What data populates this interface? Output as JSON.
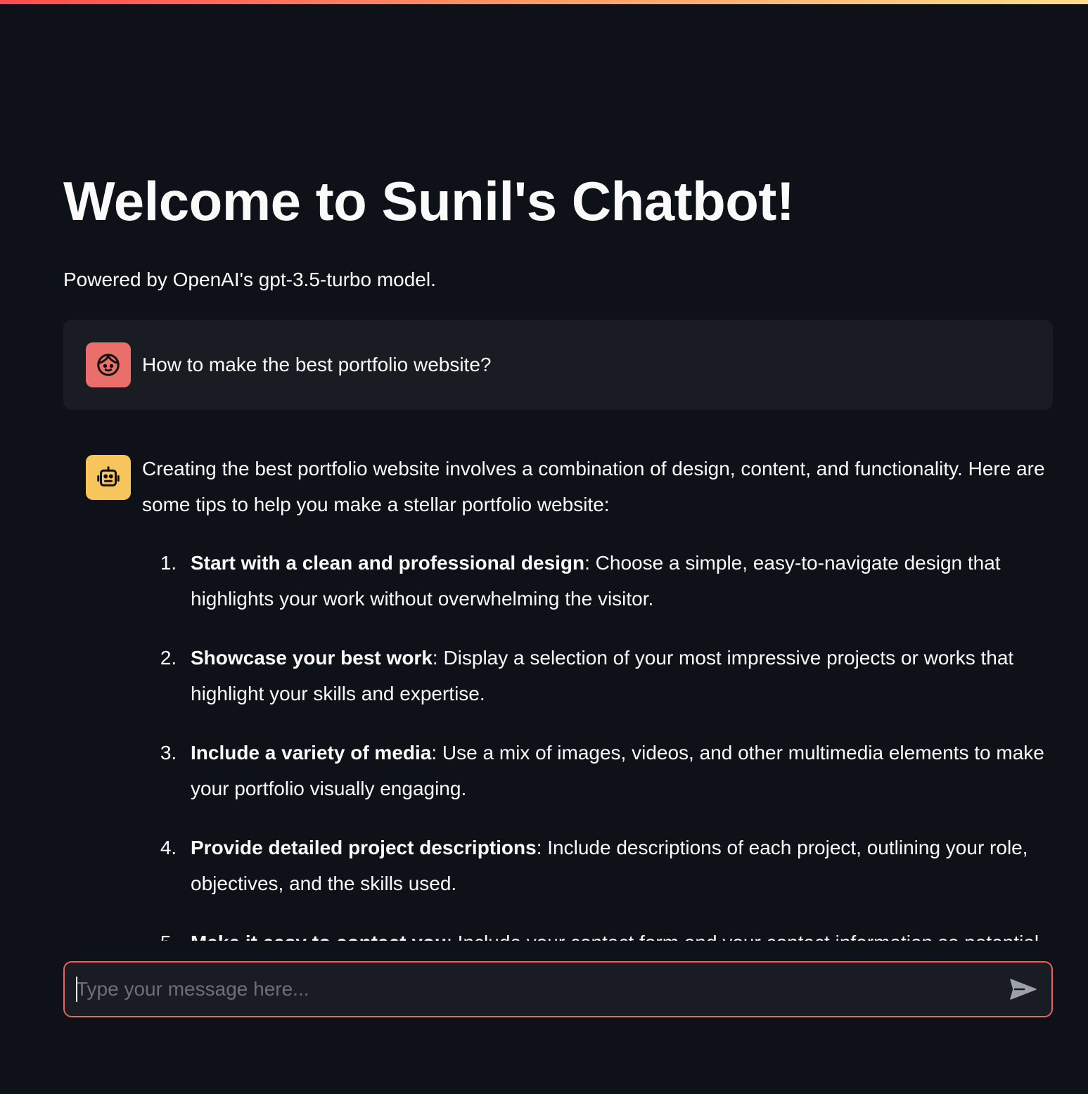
{
  "colors": {
    "background": "#0e1117",
    "text": "#fafafa",
    "user_message_bg": "#1a1c24",
    "user_avatar": "#ea6e69",
    "assistant_avatar": "#f8c45c",
    "input_border": "#e8625e"
  },
  "header": {
    "title": "Welcome to Sunil's Chatbot!",
    "subtitle": "Powered by OpenAI's gpt-3.5-turbo model."
  },
  "messages": {
    "user": {
      "avatar_icon": "smile-face-icon",
      "text": "How to make the best portfolio website?"
    },
    "assistant": {
      "avatar_icon": "robot-icon",
      "intro": "Creating the best portfolio website involves a combination of design, content, and functionality. Here are some tips to help you make a stellar portfolio website:",
      "tips": [
        {
          "title": "Start with a clean and professional design",
          "text": ": Choose a simple, easy-to-navigate design that highlights your work without overwhelming the visitor."
        },
        {
          "title": "Showcase your best work",
          "text": ": Display a selection of your most impressive projects or works that highlight your skills and expertise."
        },
        {
          "title": "Include a variety of media",
          "text": ": Use a mix of images, videos, and other multimedia elements to make your portfolio visually engaging."
        },
        {
          "title": "Provide detailed project descriptions",
          "text": ": Include descriptions of each project, outlining your role, objectives, and the skills used."
        },
        {
          "title": "Make it easy to contact you",
          "text": ": Include your contact form and your contact information so potential clients can reach you."
        }
      ]
    }
  },
  "chat_input": {
    "placeholder": "Type your message here...",
    "value": "",
    "send_icon": "send-arrow-icon"
  }
}
